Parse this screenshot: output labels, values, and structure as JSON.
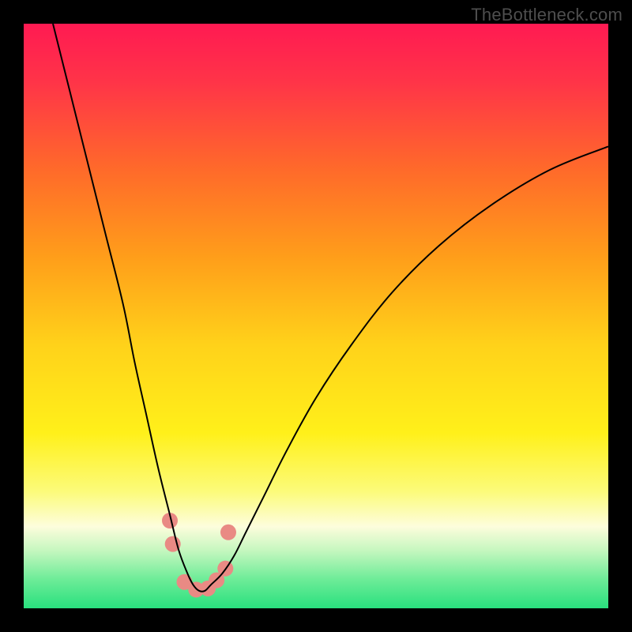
{
  "watermark": "TheBottleneck.com",
  "chart_data": {
    "type": "line",
    "title": "",
    "xlabel": "",
    "ylabel": "",
    "xlim": [
      0,
      100
    ],
    "ylim": [
      0,
      100
    ],
    "background_gradient": {
      "stops": [
        {
          "offset": 0.0,
          "color": "#ff1a52"
        },
        {
          "offset": 0.1,
          "color": "#ff3448"
        },
        {
          "offset": 0.25,
          "color": "#ff6a2a"
        },
        {
          "offset": 0.4,
          "color": "#ff9e1a"
        },
        {
          "offset": 0.55,
          "color": "#ffd21a"
        },
        {
          "offset": 0.7,
          "color": "#fff01a"
        },
        {
          "offset": 0.8,
          "color": "#fcfb7a"
        },
        {
          "offset": 0.86,
          "color": "#fdfddc"
        },
        {
          "offset": 0.9,
          "color": "#c7f7c0"
        },
        {
          "offset": 0.95,
          "color": "#6eec98"
        },
        {
          "offset": 1.0,
          "color": "#29e07e"
        }
      ]
    },
    "series": [
      {
        "name": "bottleneck-curve",
        "color": "#000000",
        "width": 2,
        "x": [
          5,
          8,
          11,
          14,
          17,
          19,
          21,
          23,
          25,
          26.5,
          28,
          29,
          30,
          31,
          32,
          34,
          36,
          38,
          41,
          45,
          50,
          56,
          63,
          71,
          80,
          90,
          100
        ],
        "y": [
          100,
          88,
          76,
          64,
          52,
          42,
          33,
          24,
          16,
          10,
          6,
          4,
          3,
          3,
          4,
          6,
          9,
          13,
          19,
          27,
          36,
          45,
          54,
          62,
          69,
          75,
          79
        ]
      }
    ],
    "markers": {
      "name": "highlight-points",
      "color": "#e98a84",
      "radius": 10,
      "points": [
        {
          "x": 25.0,
          "y": 15
        },
        {
          "x": 25.5,
          "y": 11
        },
        {
          "x": 27.5,
          "y": 4.5
        },
        {
          "x": 29.5,
          "y": 3.2
        },
        {
          "x": 31.5,
          "y": 3.4
        },
        {
          "x": 33.0,
          "y": 4.8
        },
        {
          "x": 34.5,
          "y": 6.8
        },
        {
          "x": 35.0,
          "y": 13
        }
      ]
    }
  }
}
